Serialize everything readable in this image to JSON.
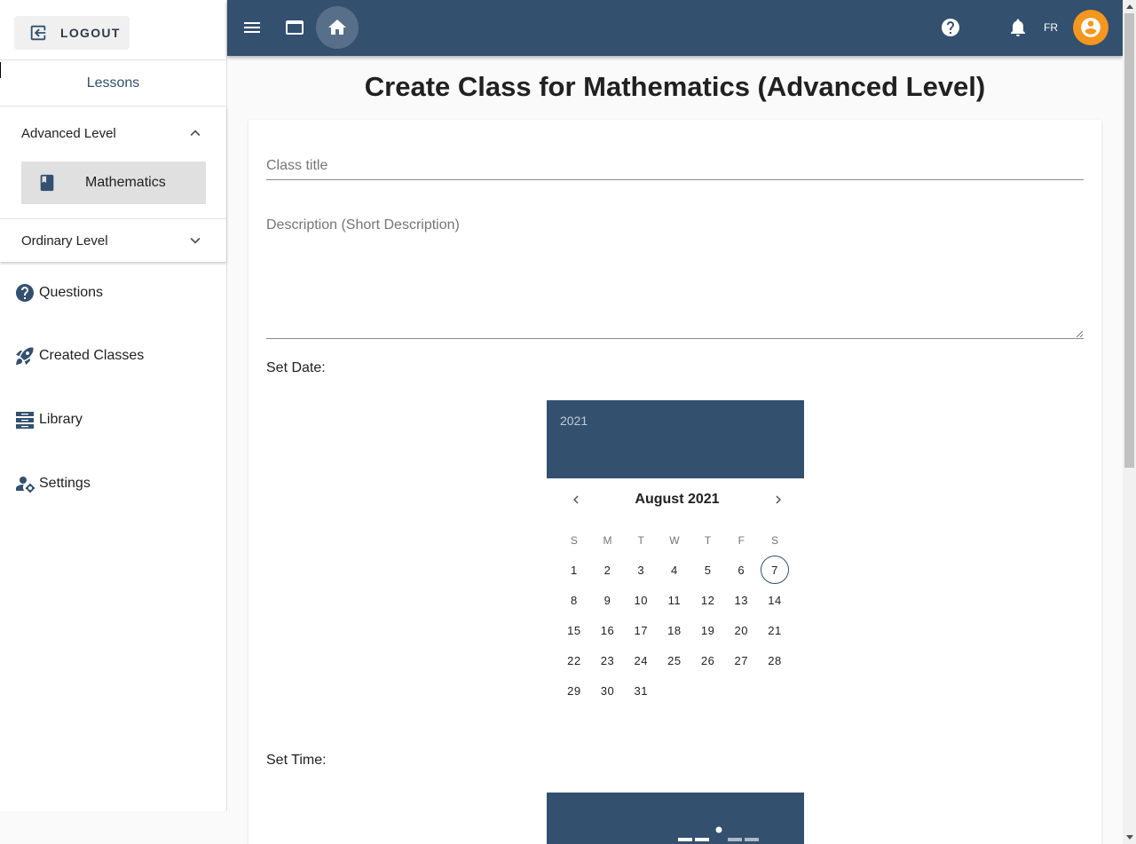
{
  "sidebar": {
    "logout_label": "LOGOUT",
    "lessons_tab": "Lessons",
    "panels": [
      {
        "label": "Advanced Level",
        "expanded": true,
        "subjects": [
          {
            "label": "Mathematics",
            "icon": "book-icon"
          }
        ]
      },
      {
        "label": "Ordinary Level",
        "expanded": false
      }
    ],
    "nav": [
      {
        "label": "Questions",
        "icon": "help-circle-icon"
      },
      {
        "label": "Created Classes",
        "icon": "rocket-icon"
      },
      {
        "label": "Library",
        "icon": "library-icon"
      },
      {
        "label": "Settings",
        "icon": "user-settings-icon"
      }
    ]
  },
  "topbar": {
    "language": "FR",
    "icons": [
      "menu-icon",
      "window-icon",
      "home-icon",
      "help-icon",
      "bell-icon",
      "account-icon"
    ]
  },
  "main": {
    "title": "Create Class for Mathematics (Advanced Level)",
    "class_title_placeholder": "Class title",
    "class_title_value": "",
    "description_placeholder": "Description (Short Description)",
    "description_value": "",
    "set_date_label": "Set Date:",
    "set_time_label": "Set Time:"
  },
  "calendar": {
    "year": "2021",
    "month_label": "August 2021",
    "weekdays": [
      "S",
      "M",
      "T",
      "W",
      "T",
      "F",
      "S"
    ],
    "start_offset": 0,
    "days_in_month": 31,
    "today": 7
  },
  "colors": {
    "primary": "#33506f",
    "accent": "#f5961f",
    "selected_bg": "#e0e0e0"
  }
}
